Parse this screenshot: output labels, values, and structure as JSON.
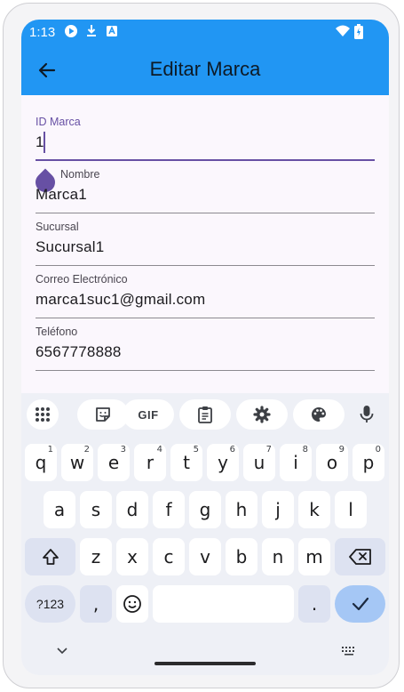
{
  "status_bar": {
    "time": "1:13"
  },
  "app_bar": {
    "title": "Editar Marca"
  },
  "form": {
    "fields": [
      {
        "label": "ID Marca",
        "value": "1"
      },
      {
        "label": "Nombre",
        "value": "Marca1"
      },
      {
        "label": "Sucursal",
        "value": "Sucursal1"
      },
      {
        "label": "Correo Electrónico",
        "value": "marca1suc1@gmail.com"
      },
      {
        "label": "Teléfono",
        "value": "6567778888"
      }
    ]
  },
  "keyboard": {
    "toolbar": {
      "gif_label": "GIF"
    },
    "row1": [
      "q",
      "w",
      "e",
      "r",
      "t",
      "y",
      "u",
      "i",
      "o",
      "p"
    ],
    "row1_hints": [
      "1",
      "2",
      "3",
      "4",
      "5",
      "6",
      "7",
      "8",
      "9",
      "0"
    ],
    "row2": [
      "a",
      "s",
      "d",
      "f",
      "g",
      "h",
      "j",
      "k",
      "l"
    ],
    "row3": [
      "z",
      "x",
      "c",
      "v",
      "b",
      "n",
      "m"
    ],
    "symbols_label": "?123",
    "comma_label": ",",
    "period_label": ".",
    "accent_color": "#a5c7f5"
  },
  "colors": {
    "app_bar": "#2196f3",
    "focus": "#6750a4",
    "background": "#fbf7fd"
  }
}
